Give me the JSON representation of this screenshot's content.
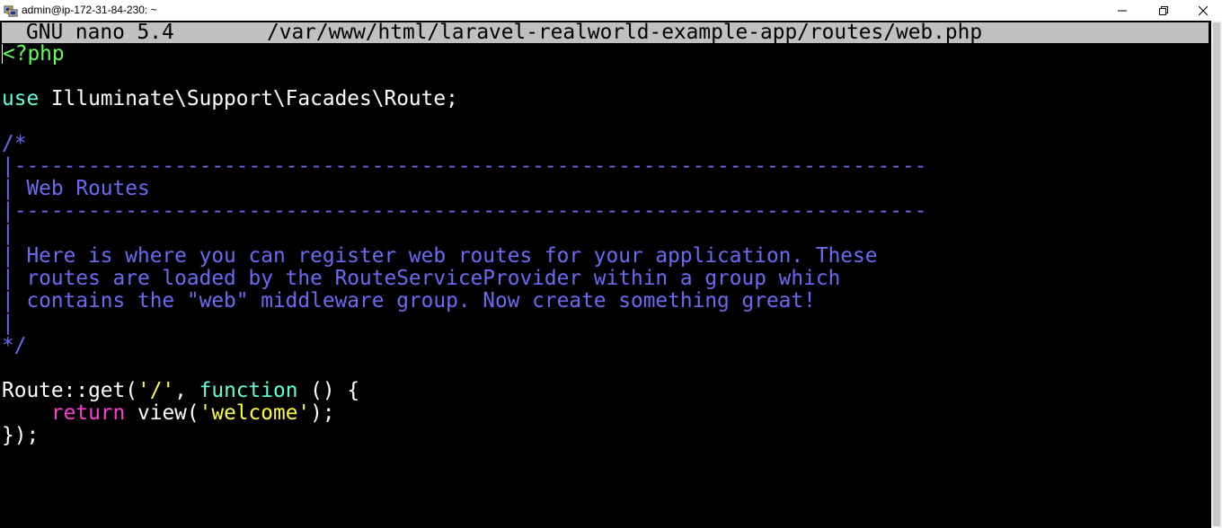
{
  "window": {
    "title": "admin@ip-172-31-84-230: ~",
    "icons": {
      "app": "putty-icon",
      "minimize": "minimize-icon",
      "maximize": "restore-icon",
      "close": "close-icon"
    }
  },
  "nano": {
    "version": "GNU nano 5.4",
    "file_path": "/var/www/html/laravel-realworld-example-app/routes/web.php"
  },
  "colors": {
    "header_bg": "#c0c0c0",
    "php_tag": "#60ff60",
    "keyword": "#5fffd7",
    "comment": "#6a6af5",
    "return_keyword": "#ff3fd3",
    "string": "#ffff40",
    "default_text": "#cccccc"
  },
  "code": {
    "php_open": "<?php",
    "use_keyword": "use",
    "use_path": " Illuminate\\Support\\Facades\\Route;",
    "comment_lines": [
      "/*",
      "|--------------------------------------------------------------------------",
      "| Web Routes",
      "|--------------------------------------------------------------------------",
      "|",
      "| Here is where you can register web routes for your application. These",
      "| routes are loaded by the RouteServiceProvider within a group which",
      "| contains the \"web\" middleware group. Now create something great!",
      "|",
      "*/"
    ],
    "route_prefix": "Route::get(",
    "route_arg": "'/'",
    "route_sep": ", ",
    "route_function": "function",
    "route_suffix": " () {",
    "return_indent": "    ",
    "return_keyword": "return",
    "return_call": " view(",
    "return_arg": "'welcome'",
    "return_end": ");",
    "closing": "});"
  }
}
